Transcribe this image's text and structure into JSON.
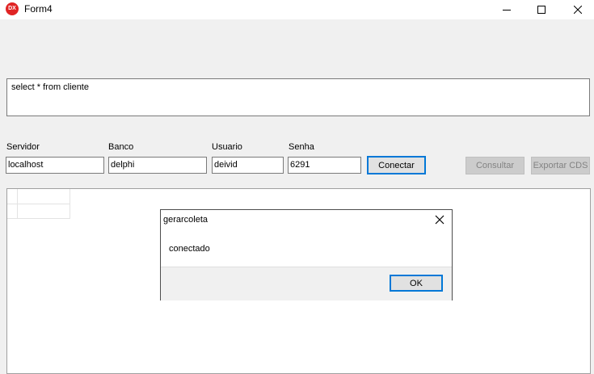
{
  "window": {
    "title": "Form4",
    "icon_label": "DX"
  },
  "query": {
    "text": "select * from cliente"
  },
  "fields": [
    {
      "label": "Servidor",
      "value": "localhost"
    },
    {
      "label": "Banco",
      "value": "delphi"
    },
    {
      "label": "Usuario",
      "value": "deivid"
    },
    {
      "label": "Senha",
      "value": "6291"
    }
  ],
  "buttons": {
    "connect": "Conectar",
    "query": "Consultar",
    "export": "Exportar CDS"
  },
  "dialog": {
    "title": "gerarcoleta",
    "message": "conectado",
    "ok": "OK"
  }
}
